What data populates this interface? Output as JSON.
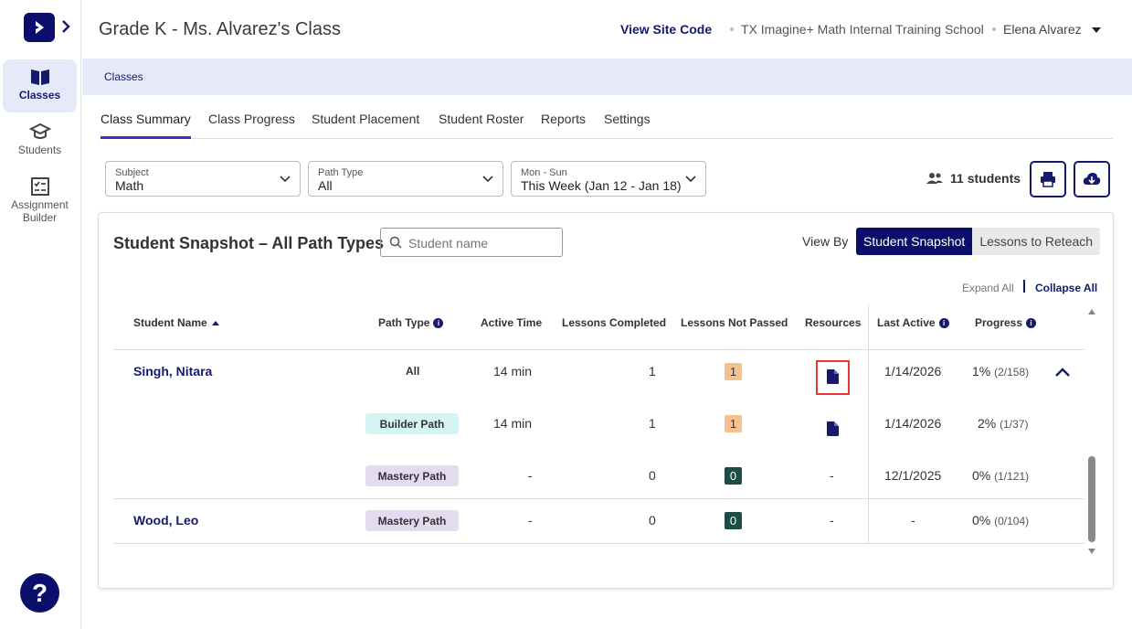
{
  "sidebar": {
    "items": [
      {
        "label": "Classes",
        "icon": "book-icon",
        "active": true
      },
      {
        "label": "Students",
        "icon": "graduation-cap-icon",
        "active": false
      },
      {
        "label": "Assignment Builder",
        "icon": "checklist-icon",
        "active": false
      }
    ],
    "help_label": "?"
  },
  "header": {
    "title": "Grade K - Ms. Alvarez's Class",
    "view_site_code": "View Site Code",
    "school": "TX Imagine+ Math Internal Training School",
    "user": "Elena  Alvarez"
  },
  "breadcrumb": "Classes",
  "tabs": [
    "Class Summary",
    "Class Progress",
    "Student Placement",
    "Student Roster",
    "Reports",
    "Settings"
  ],
  "filters": {
    "subject": {
      "label": "Subject",
      "value": "Math"
    },
    "path_type": {
      "label": "Path Type",
      "value": "All"
    },
    "week": {
      "label": "Mon - Sun",
      "value": "This Week (Jan 12 - Jan 18)"
    }
  },
  "students_count": "11 students",
  "card": {
    "title": "Student Snapshot – All Path Types",
    "search_placeholder": "Student name",
    "view_by": "View By",
    "toggle": [
      "Student Snapshot",
      "Lessons to Reteach"
    ],
    "expand_all": "Expand All",
    "collapse_all": "Collapse All"
  },
  "columns": [
    "Student Name",
    "Path Type",
    "Active Time",
    "Lessons Completed",
    "Lessons Not Passed",
    "Resources",
    "Last Active",
    "Progress"
  ],
  "rows": [
    {
      "name": "Singh, Nitara",
      "path": "All",
      "time": "14 min",
      "completed": "1",
      "not_passed": "1",
      "resources": "doc",
      "last_active": "1/14/2026",
      "progress": "1%",
      "progress_detail": "(2/158)"
    },
    {
      "name": "",
      "path": "Builder Path",
      "time": "14 min",
      "completed": "1",
      "not_passed": "1",
      "resources": "doc",
      "last_active": "1/14/2026",
      "progress": "2%",
      "progress_detail": "(1/37)"
    },
    {
      "name": "",
      "path": "Mastery Path",
      "time": "-",
      "completed": "0",
      "not_passed": "0",
      "resources": "-",
      "last_active": "12/1/2025",
      "progress": "0%",
      "progress_detail": "(1/121)"
    },
    {
      "name": "Wood, Leo",
      "path": "Mastery Path",
      "time": "-",
      "completed": "0",
      "not_passed": "0",
      "resources": "-",
      "last_active": "-",
      "progress": "0%",
      "progress_detail": "(0/104)"
    }
  ],
  "colors": {
    "brand": "#0c0e6b",
    "accent": "#3c33b8",
    "highlight": "#e03a3a"
  }
}
